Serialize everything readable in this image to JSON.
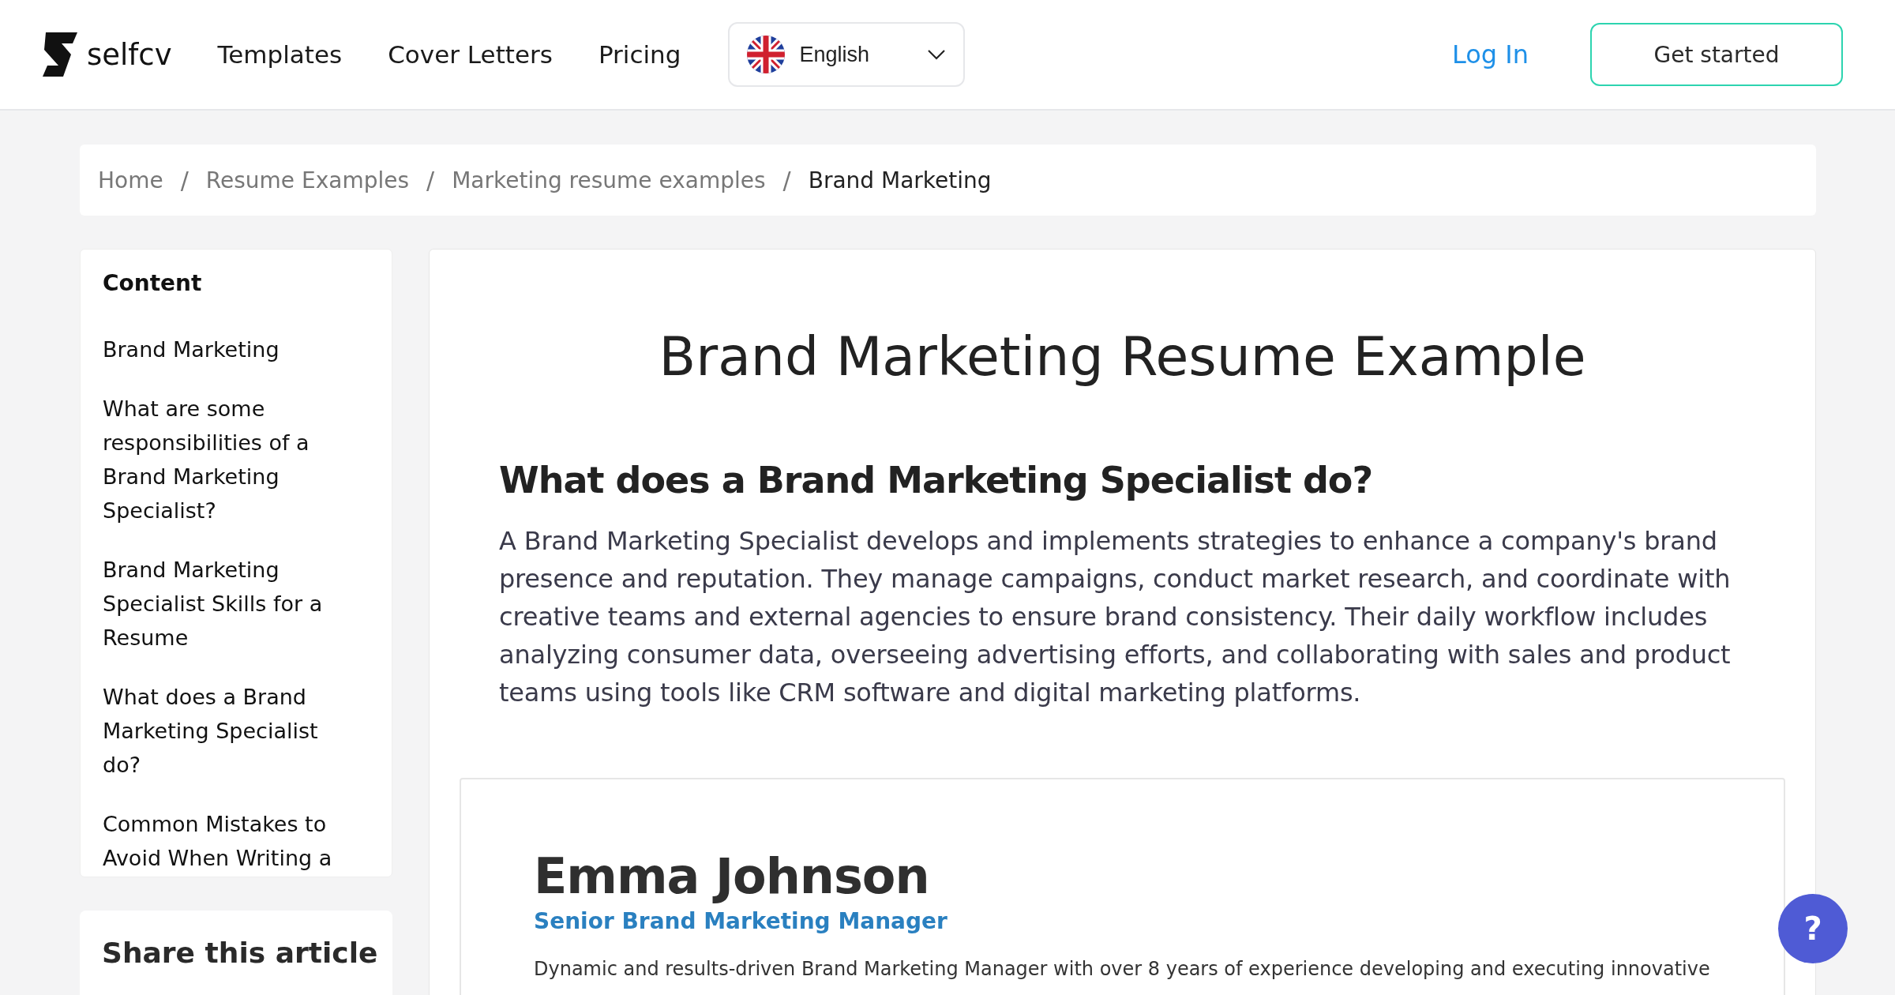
{
  "header": {
    "logo": "selfcv",
    "nav": [
      "Templates",
      "Cover Letters",
      "Pricing"
    ],
    "language": "English",
    "login": "Log In",
    "cta": "Get started"
  },
  "breadcrumb": [
    {
      "label": "Home",
      "current": false
    },
    {
      "label": "Resume Examples",
      "current": false
    },
    {
      "label": "Marketing resume examples",
      "current": false
    },
    {
      "label": "Brand Marketing",
      "current": true
    }
  ],
  "separator": "/",
  "sidebar": {
    "title": "Content",
    "items": [
      "Brand Marketing",
      "What are some responsibilities of a Brand Marketing Specialist?",
      "Brand Marketing Specialist Skills for a Resume",
      "What does a Brand Marketing Specialist do?",
      "Common Mistakes to Avoid When Writing a"
    ]
  },
  "share": {
    "title": "Share this article"
  },
  "article": {
    "title": "Brand Marketing Resume Example",
    "heading": "What does a Brand Marketing Specialist do?",
    "paragraph": "A Brand Marketing Specialist develops and implements strategies to enhance a company's brand presence and reputation. They manage campaigns, conduct market research, and coordinate with creative teams and external agencies to ensure brand consistency. Their daily workflow includes analyzing consumer data, overseeing advertising efforts, and collaborating with sales and product teams using tools like CRM software and digital marketing platforms."
  },
  "resume": {
    "name": "Emma Johnson",
    "role": "Senior Brand Marketing Manager",
    "summary": "Dynamic and results-driven Brand Marketing Manager with over 8 years of experience developing and executing innovative"
  },
  "help": "?"
}
